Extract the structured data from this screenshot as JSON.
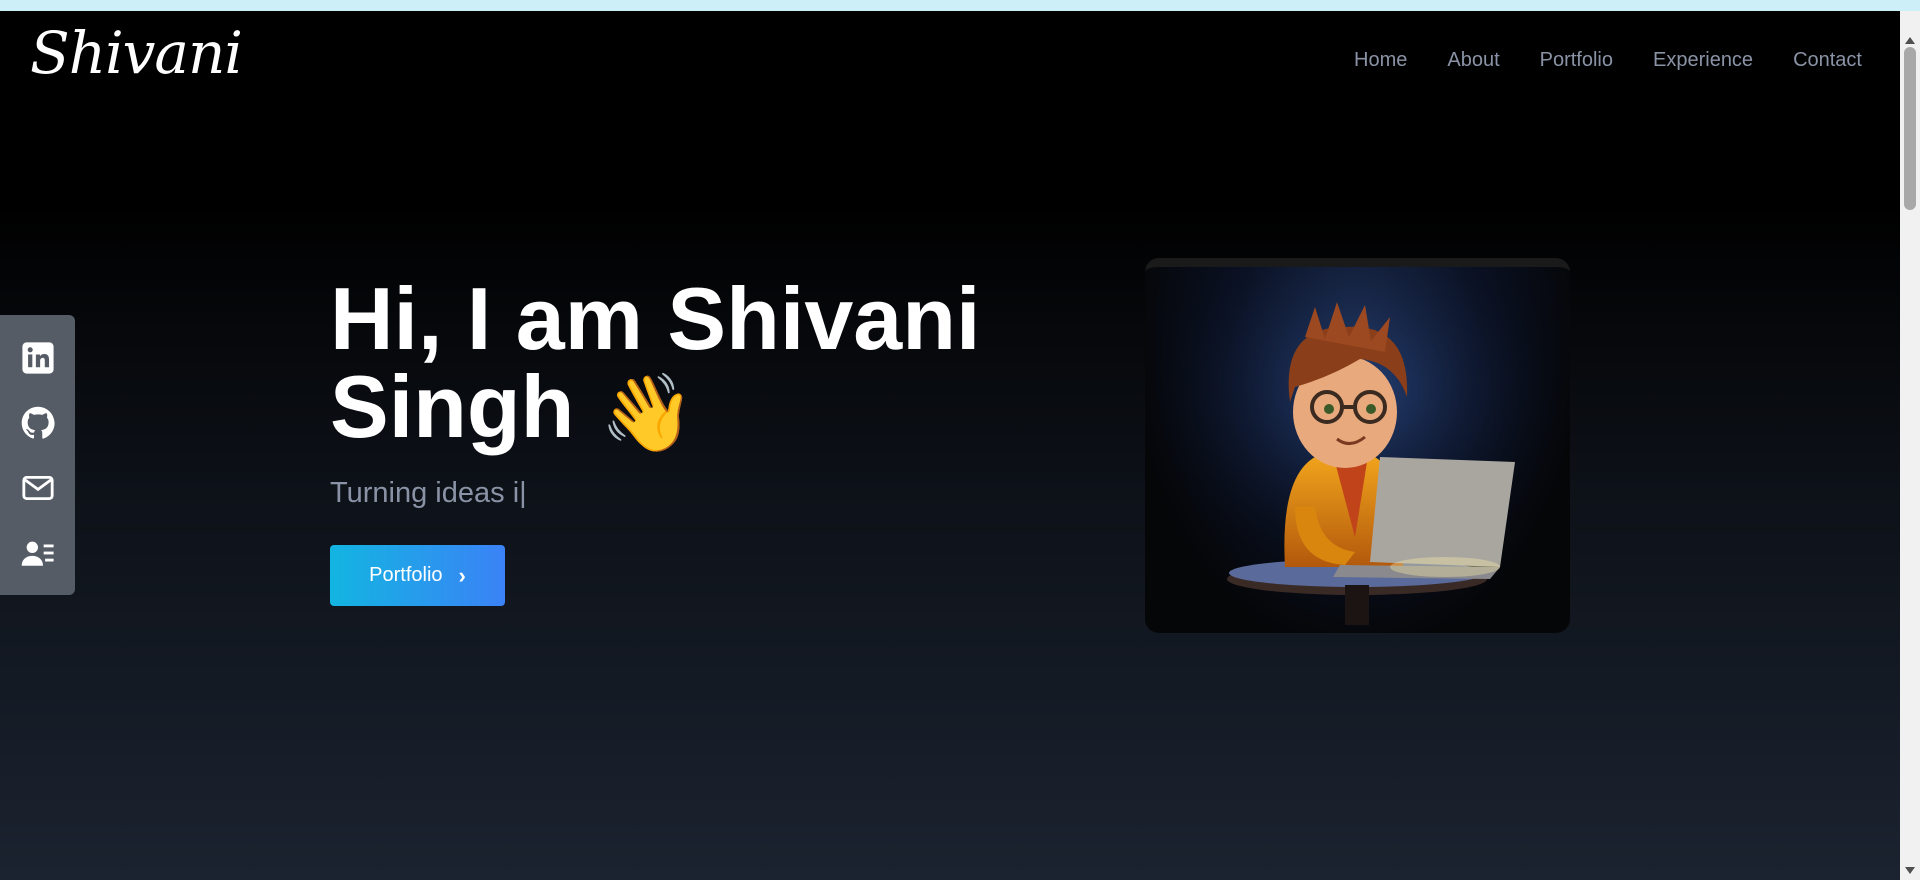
{
  "header": {
    "logo": "Shivani",
    "nav": [
      {
        "label": "Home"
      },
      {
        "label": "About"
      },
      {
        "label": "Portfolio"
      },
      {
        "label": "Experience"
      },
      {
        "label": "Contact"
      }
    ]
  },
  "social": [
    {
      "icon": "linkedin-icon"
    },
    {
      "icon": "github-icon"
    },
    {
      "icon": "mail-icon"
    },
    {
      "icon": "resume-icon"
    }
  ],
  "hero": {
    "title_line1": "Hi, I am Shivani",
    "title_line2": "Singh",
    "wave_emoji": "👋",
    "tagline": "Turning ideas i|",
    "cta_label": "Portfolio",
    "cta_icon": "chevron-right-icon"
  },
  "illustration": {
    "icon": "developer-with-laptop-illustration"
  },
  "colors": {
    "accent_from": "#12b5e1",
    "accent_to": "#3b82f6",
    "nav_text": "#8a93a6",
    "social_bg": "#565c66"
  }
}
